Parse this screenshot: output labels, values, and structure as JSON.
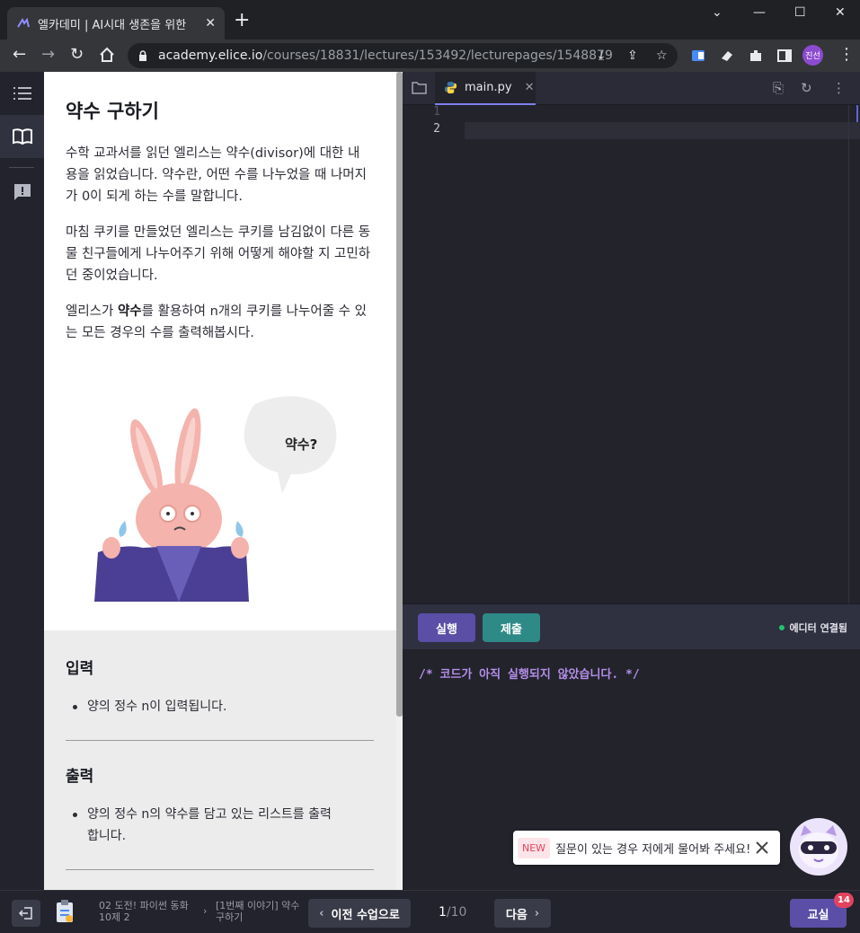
{
  "browser": {
    "tab_title": "엘카데미 | AI시대 생존을 위한 ",
    "url_host": "academy.elice.io",
    "url_path": "/courses/18831/lectures/153492/lecturepages/1548879",
    "profile_initials": "진선"
  },
  "lesson": {
    "title": "약수 구하기",
    "paragraphs": [
      "수학 교과서를 읽던 엘리스는 약수(divisor)에 대한 내용을 읽었습니다. 약수란, 어떤 수를 나누었을 때 나머지가 0이 되게 하는 수를 말합니다.",
      "마침 쿠키를 만들었던 엘리스는 쿠키를 남김없이 다른 동물 친구들에게 나누어주기 위해 어떻게 해야할 지 고민하던 중이었습니다."
    ],
    "para3_pre": "엘리스가 ",
    "para3_bold": "약수",
    "para3_post": "를 활용하여 n개의 쿠키를 나누어줄 수 있는 모든 경우의 수를 출력해봅시다.",
    "bubble_text": "약수?",
    "input_title": "입력",
    "input_item": "양의 정수 n이 입력됩니다.",
    "output_title": "출력",
    "output_item": "양의 정수 n의 약수를 담고 있는 리스트를 출력합니다."
  },
  "editor": {
    "filename": "main.py",
    "line_numbers": [
      "1",
      "2"
    ],
    "run_label": "실행",
    "submit_label": "제출",
    "connection_status": "에디터 연결됨",
    "terminal_output": "/* 코드가 아직 실행되지 않았습니다. */"
  },
  "chatbot": {
    "new_label": "NEW",
    "message": "질문이 있는 경우 저에게 물어봐 주세요!"
  },
  "footer": {
    "course_crumb": "02 도전! 파이썬 동화 10제 2",
    "lecture_crumb": "[1번째 이야기] 약수 구하기",
    "prev_label": "이전 수업으로",
    "page_current": "1",
    "page_total": "/10",
    "next_label": "다음",
    "class_label": "교실",
    "notification_count": "14"
  },
  "colors": {
    "accent": "#5a4ea6",
    "submit": "#2e8a87",
    "terminal_text": "#b48ee8",
    "status_ok": "#20c46d",
    "badge": "#e3435f"
  }
}
